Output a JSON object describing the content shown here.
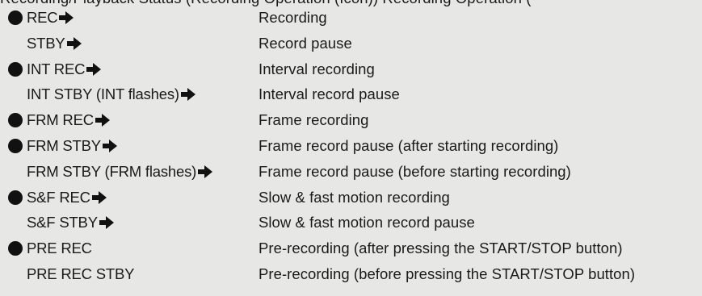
{
  "clipped_heading": "Recording/Playback Status (Recording Operation (Icon)) Recording Operation (",
  "rows": [
    {
      "dot": true,
      "code": "REC",
      "arrow": true,
      "description": "Recording"
    },
    {
      "dot": false,
      "code": "STBY",
      "arrow": true,
      "description": "Record pause"
    },
    {
      "dot": true,
      "code": "INT REC",
      "arrow": true,
      "description": "Interval recording"
    },
    {
      "dot": false,
      "code": "INT STBY (INT flashes)",
      "arrow": true,
      "description": "Interval record pause"
    },
    {
      "dot": true,
      "code": "FRM REC",
      "arrow": true,
      "description": "Frame recording"
    },
    {
      "dot": true,
      "code": "FRM STBY",
      "arrow": true,
      "description": "Frame record pause (after starting recording)"
    },
    {
      "dot": false,
      "code": "FRM STBY (FRM flashes)",
      "arrow": true,
      "description": "Frame record pause (before starting recording)"
    },
    {
      "dot": true,
      "code": "S&F REC",
      "arrow": true,
      "description": "Slow & fast motion recording"
    },
    {
      "dot": false,
      "code": "S&F STBY",
      "arrow": true,
      "description": "Slow & fast motion record pause"
    },
    {
      "dot": true,
      "code": "PRE REC",
      "arrow": false,
      "description": "Pre-recording (after pressing the START/STOP button)"
    },
    {
      "dot": false,
      "code": "PRE REC STBY",
      "arrow": false,
      "description": "Pre-recording (before pressing the START/STOP button)"
    }
  ],
  "icons": {
    "dot": "record-dot-icon",
    "arrow": "right-arrow-icon"
  },
  "colors": {
    "background": "#e7e7e6",
    "text": "#1a1a1a",
    "icon": "#111111"
  }
}
